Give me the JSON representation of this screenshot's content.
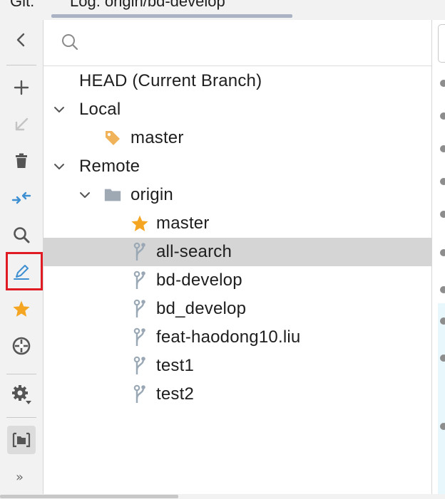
{
  "topbar": {
    "git_label": "Git:",
    "log_tab": "Log: origin/bd-develop"
  },
  "toolbar": {
    "items": [
      {
        "icon": "collapse-panel-icon"
      },
      {
        "icon": "new-branch-icon"
      },
      {
        "icon": "update-selected-icon"
      },
      {
        "icon": "delete-branch-icon"
      },
      {
        "icon": "compare-branches-icon"
      },
      {
        "icon": "search-icon"
      },
      {
        "icon": "edit-branch-icon",
        "highlighted": true
      },
      {
        "icon": "favorite-star-icon"
      },
      {
        "icon": "locate-branch-icon"
      },
      {
        "icon": "settings-gear-icon"
      },
      {
        "icon": "group-by-directory-icon"
      },
      {
        "icon": "more-actions-icon",
        "label": "»"
      }
    ],
    "accent_color": "#3d8fd1",
    "highlight_color": "#e01b24"
  },
  "search": {
    "value": "",
    "placeholder": ""
  },
  "tree": {
    "head_label": "HEAD (Current Branch)",
    "local": {
      "label": "Local",
      "branches": [
        {
          "name": "master",
          "icon": "tag-icon"
        }
      ]
    },
    "remote": {
      "label": "Remote",
      "origin": {
        "label": "origin",
        "branches": [
          {
            "name": "master",
            "icon": "star-icon"
          },
          {
            "name": "all-search",
            "icon": "branch-icon",
            "selected": true
          },
          {
            "name": "bd-develop",
            "icon": "branch-icon"
          },
          {
            "name": "bd_develop",
            "icon": "branch-icon"
          },
          {
            "name": "feat-haodong10.liu",
            "icon": "branch-icon"
          },
          {
            "name": "test1",
            "icon": "branch-icon"
          },
          {
            "name": "test2",
            "icon": "branch-icon"
          }
        ]
      }
    }
  },
  "colors": {
    "selection": "#d5d5d5",
    "star": "#f4a622",
    "tag": "#f0b35a",
    "branch_icon": "#9aa8b5",
    "folder": "#9ea9b4"
  }
}
